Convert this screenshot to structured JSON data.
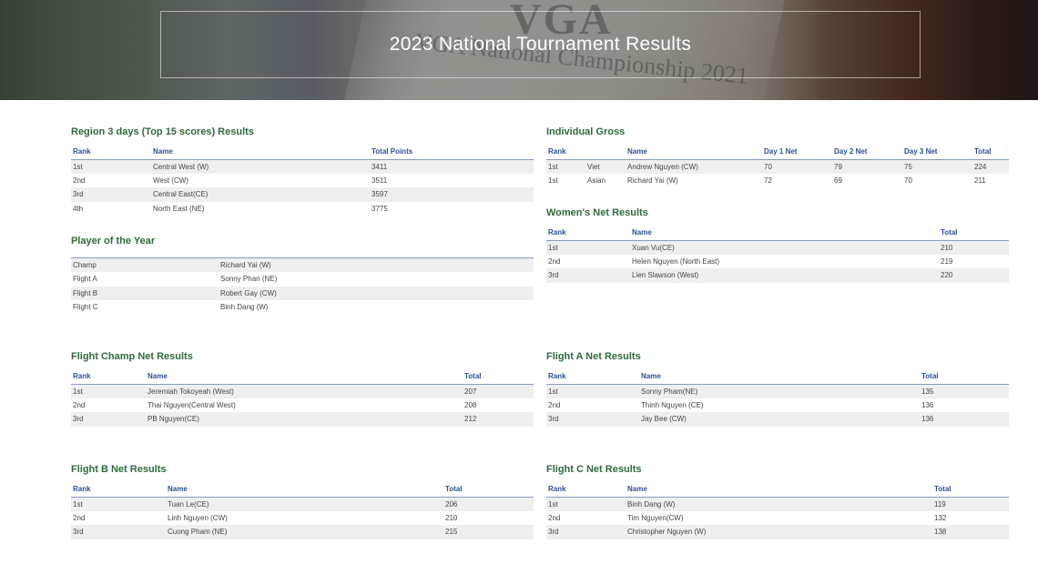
{
  "page_title": "2023 National Tournament Results",
  "banner_text": {
    "line1": "VGA",
    "line2": "VGA National Championship 2021"
  },
  "region": {
    "title": "Region 3 days (Top 15 scores) Results",
    "headers": [
      "Rank",
      "Name",
      "Total Points"
    ],
    "rows": [
      [
        "1st",
        "Central West (W)",
        "3411"
      ],
      [
        "2nd",
        "West (CW)",
        "3511"
      ],
      [
        "3rd",
        "Central East(CE)",
        "3597"
      ],
      [
        "4th",
        "North East (NE)",
        "3775"
      ]
    ]
  },
  "poy": {
    "title": "Player of the Year",
    "rows": [
      [
        "Champ",
        "Richard Yai (W)"
      ],
      [
        "Flight A",
        "Sonny Phan (NE)"
      ],
      [
        "Flight B",
        "Robert Gay (CW)"
      ],
      [
        "Flight C",
        "Binh Dang (W)"
      ]
    ]
  },
  "gross": {
    "title": "Individual Gross",
    "headers": [
      "Rank",
      "",
      "Name",
      "Day 1 Net",
      "Day 2 Net",
      "Day 3 Net",
      "Total"
    ],
    "rows": [
      [
        "1st",
        "Viet",
        "Andrew Nguyen (CW)",
        "70",
        "79",
        "75",
        "224"
      ],
      [
        "1st",
        "Asian",
        "Richard Yai (W)",
        "72",
        "69",
        "70",
        "211"
      ]
    ]
  },
  "women": {
    "title": "Women's Net Results",
    "headers": [
      "Rank",
      "Name",
      "Total"
    ],
    "rows": [
      [
        "1st",
        "Xuan Vu(CE)",
        "210"
      ],
      [
        "2nd",
        "Helen Nguyen (North East)",
        "219"
      ],
      [
        "3rd",
        "Lien Slawson (West)",
        "220"
      ]
    ]
  },
  "champ": {
    "title": "Flight Champ Net Results",
    "headers": [
      "Rank",
      "Name",
      "Total"
    ],
    "rows": [
      [
        "1st",
        "Jeremiah Tokoyeah (West)",
        "207"
      ],
      [
        "2nd",
        "Thai Nguyen(Central West)",
        "208"
      ],
      [
        "3rd",
        "PB Nguyen(CE)",
        "212"
      ]
    ]
  },
  "flightA": {
    "title": "Flight A Net Results",
    "headers": [
      "Rank",
      "Name",
      "Total"
    ],
    "rows": [
      [
        "1st",
        "Sonny Pham(NE)",
        "135"
      ],
      [
        "2nd",
        "Thinh Nguyen (CE)",
        "136"
      ],
      [
        "3rd",
        "Jay Bee (CW)",
        "136"
      ]
    ]
  },
  "flightB": {
    "title": "Flight B Net Results",
    "headers": [
      "Rank",
      "Name",
      "Total"
    ],
    "rows": [
      [
        "1st",
        "Tuan Le(CE)",
        "206"
      ],
      [
        "2nd",
        "Linh Nguyen (CW)",
        "210"
      ],
      [
        "3rd",
        "Cuong Pham (NE)",
        "215"
      ]
    ]
  },
  "flightC": {
    "title": "Flight C Net Results",
    "headers": [
      "Rank",
      "Name",
      "Total"
    ],
    "rows": [
      [
        "1st",
        "Binh Dang (W)",
        "119"
      ],
      [
        "2nd",
        "Tim Nguyen(CW)",
        "132"
      ],
      [
        "3rd",
        "Christopher Nguyen (W)",
        "138"
      ]
    ]
  }
}
